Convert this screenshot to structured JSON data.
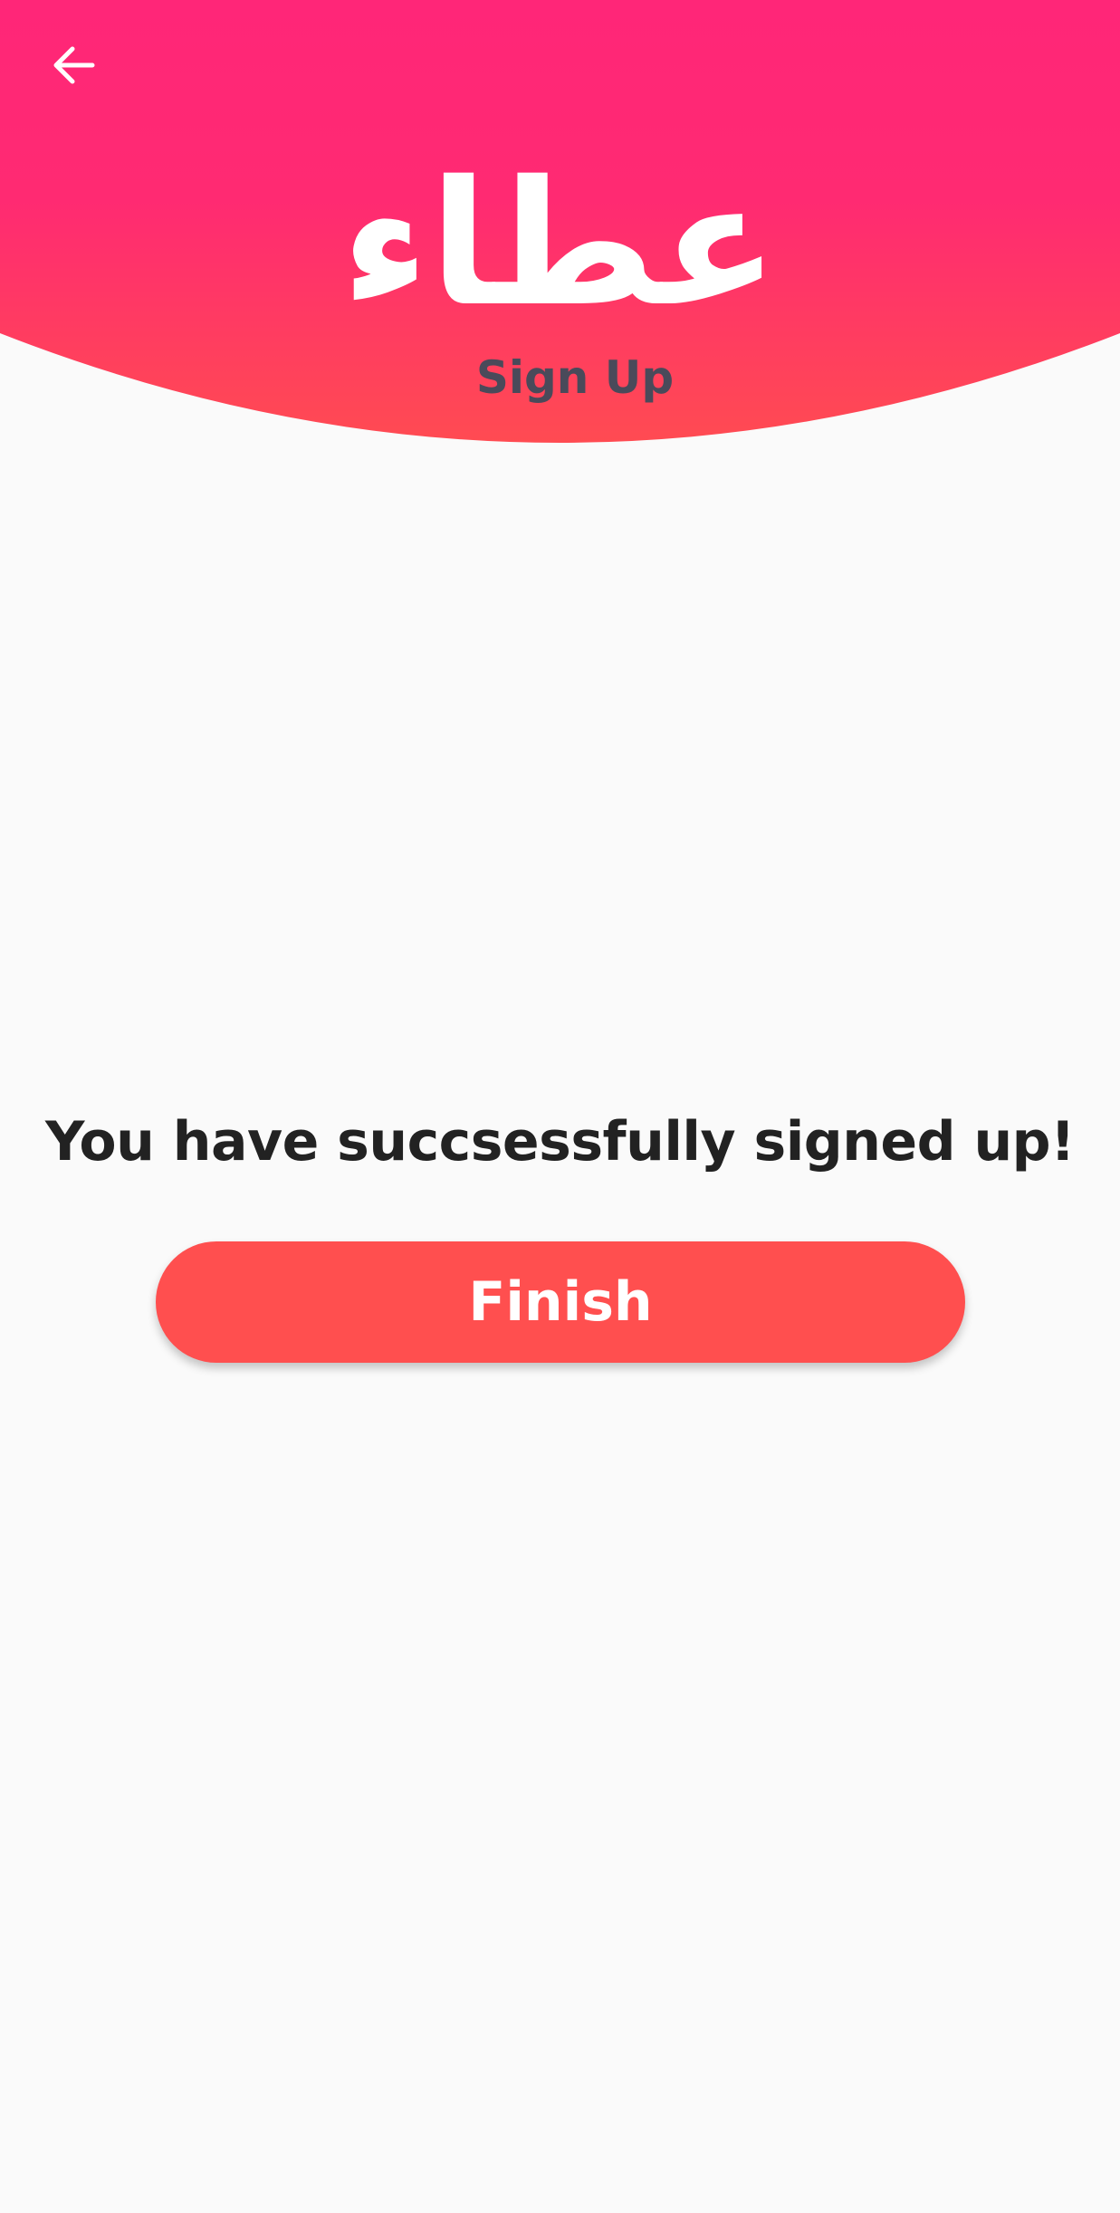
{
  "header": {
    "logo_text": "عطاء",
    "subtitle": "Sign Up",
    "back_icon": "arrow-left-icon",
    "gradient_top_color": "#ff2678",
    "gradient_bottom_color": "#ff4b52"
  },
  "main": {
    "message": "You have succsessfully signed up!",
    "finish_label": "Finish",
    "finish_button_color": "#ff4f4f"
  },
  "colors": {
    "background": "#fafafa",
    "subtitle_text": "#4a4a5a",
    "message_text": "#222222"
  }
}
